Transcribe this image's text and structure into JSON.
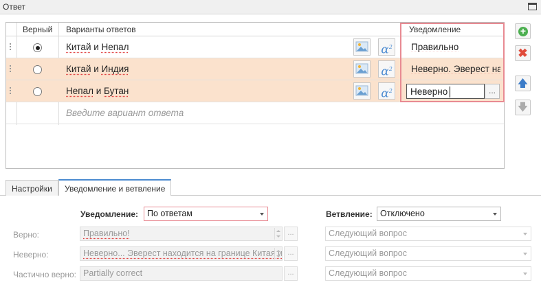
{
  "window": {
    "title": "Ответ"
  },
  "grid": {
    "headers": {
      "correct": "Верный",
      "answers": "Варианты ответов",
      "notification": "Уведомление"
    },
    "rows": [
      {
        "answer_a": "Китай",
        "and": " и ",
        "answer_b": "Непал",
        "notification": "Правильно",
        "correct": true
      },
      {
        "answer_a": "Китай",
        "and": " и ",
        "answer_b": "Индия",
        "notification": "Неверно. Эверест на границе",
        "correct": false
      },
      {
        "answer_a": "Непал",
        "and": " и ",
        "answer_b": "Бутан",
        "notification": "Неверно",
        "correct": false
      }
    ],
    "new_row_placeholder": "Введите вариант ответа",
    "ellipsis": "..."
  },
  "tabs": [
    {
      "label": "Настройки"
    },
    {
      "label": "Уведомление и ветвление"
    }
  ],
  "form": {
    "notification_label": "Уведомление:",
    "notification_value": "По ответам",
    "branch_label": "Ветвление:",
    "branch_value": "Отключено",
    "correct_label": "Верно:",
    "correct_value": "Правильно!",
    "incorrect_label": "Неверно:",
    "incorrect_value": "Неверно... Эверест находится на границе Китая и",
    "partial_label": "Частично верно:",
    "partial_value": "Partially correct",
    "next_question": "Следующий вопрос",
    "ellipsis": "..."
  },
  "colors": {
    "accent": "#4a8ad0",
    "selected_row": "#fbe2cd",
    "highlight": "#e88a92"
  }
}
